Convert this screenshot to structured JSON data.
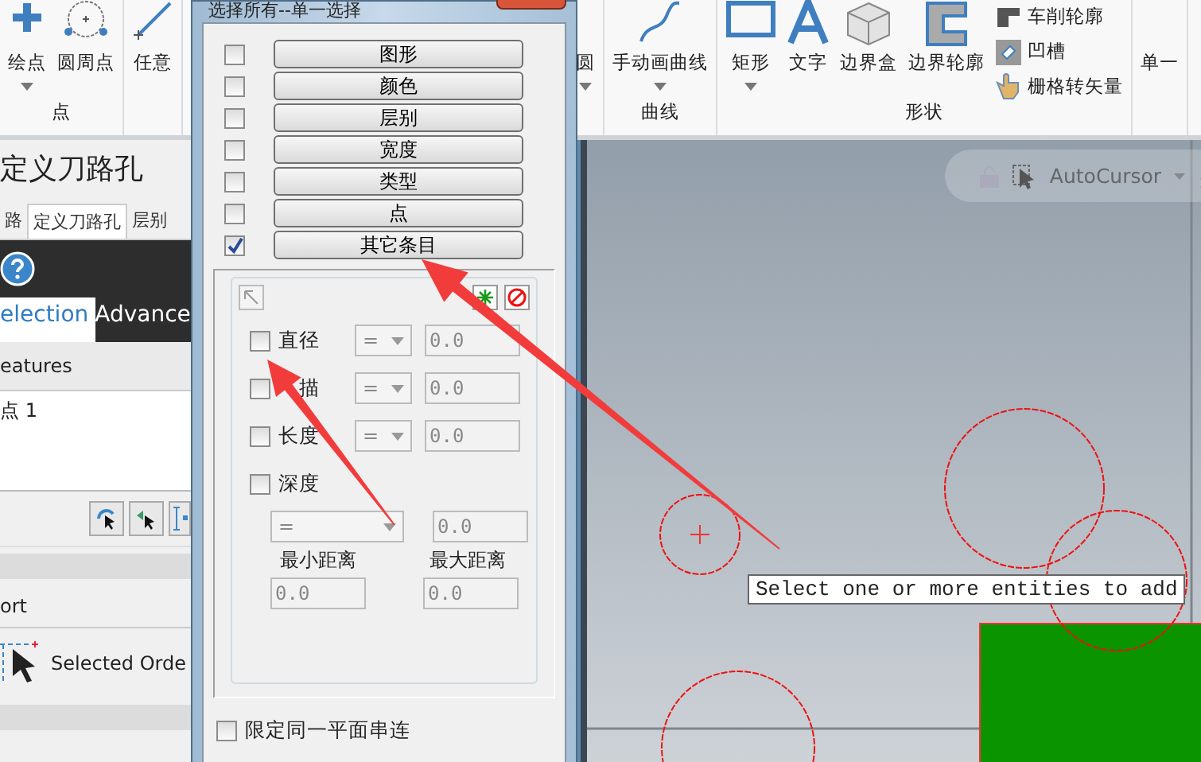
{
  "ribbon": {
    "sections": [
      {
        "label": "点",
        "tools": [
          {
            "label": "绘点",
            "kind": "plus",
            "dropdown": true
          },
          {
            "label": "圆周点",
            "kind": "circle-points",
            "dropdown": false
          }
        ]
      },
      {
        "tools": [
          {
            "label": "任意",
            "kind": "line",
            "dropdown": false
          }
        ]
      },
      {
        "tools": [
          {
            "label": "圆",
            "kind": "none",
            "dropdown": true
          }
        ]
      },
      {
        "label": "曲线",
        "tools": [
          {
            "label": "手动画曲线",
            "kind": "curve",
            "dropdown": true
          }
        ]
      },
      {
        "label": "形状",
        "tools": [
          {
            "label": "矩形",
            "kind": "rectangle",
            "dropdown": true
          },
          {
            "label": "文字",
            "kind": "letter",
            "dropdown": false
          },
          {
            "label": "边界盒",
            "kind": "cube",
            "dropdown": false
          },
          {
            "label": "边界轮廓",
            "kind": "outline",
            "dropdown": false
          }
        ],
        "small_tools": [
          {
            "label": "车削轮廓",
            "kind": "profile"
          },
          {
            "label": "凹槽",
            "kind": "groove"
          },
          {
            "label": "栅格转矢量",
            "kind": "hand"
          }
        ]
      },
      {
        "tools": [
          {
            "label": "单一",
            "kind": "none",
            "dropdown": false
          }
        ]
      }
    ]
  },
  "panel": {
    "title": "定义刀路孔",
    "tabs": [
      {
        "label": "路",
        "selected": false
      },
      {
        "label": "定义刀路孔",
        "selected": true
      },
      {
        "label": "层别",
        "selected": false
      }
    ],
    "subtabs": [
      {
        "label": "election",
        "selected": true
      },
      {
        "label": "Advance",
        "selected": false
      }
    ],
    "list_header": "eatures",
    "list_items": [
      "点 1"
    ],
    "section": "ort",
    "order_option": "Selected Orde"
  },
  "dialog": {
    "title": "选择所有--单一选择",
    "categories": [
      {
        "label": "图形",
        "checked": false
      },
      {
        "label": "颜色",
        "checked": false
      },
      {
        "label": "层别",
        "checked": false
      },
      {
        "label": "宽度",
        "checked": false
      },
      {
        "label": "类型",
        "checked": false
      },
      {
        "label": "点",
        "checked": false
      },
      {
        "label": "其它条目",
        "checked": true
      }
    ],
    "filters": [
      {
        "kind": "row",
        "label": "直径",
        "checked": false,
        "disabled": true,
        "operator": "=",
        "value": "0.0"
      },
      {
        "kind": "row",
        "label": "描",
        "checked": false,
        "disabled": true,
        "operator": "=",
        "value": "0.0"
      },
      {
        "kind": "row",
        "label": "长度",
        "checked": false,
        "disabled": true,
        "operator": "=",
        "value": "0.0"
      },
      {
        "kind": "range",
        "label": "深度",
        "checked": false,
        "disabled": true,
        "operator": "=",
        "value": "0.0",
        "min_label": "最小距离",
        "min_value": "0.0",
        "max_label": "最大距离",
        "max_value": "0.0"
      }
    ],
    "options": [
      {
        "label": "限定同一平面串连",
        "checked": false
      }
    ]
  },
  "canvas": {
    "toolbar_label": "AutoCursor",
    "tooltip": "Select one or more entities to add"
  }
}
